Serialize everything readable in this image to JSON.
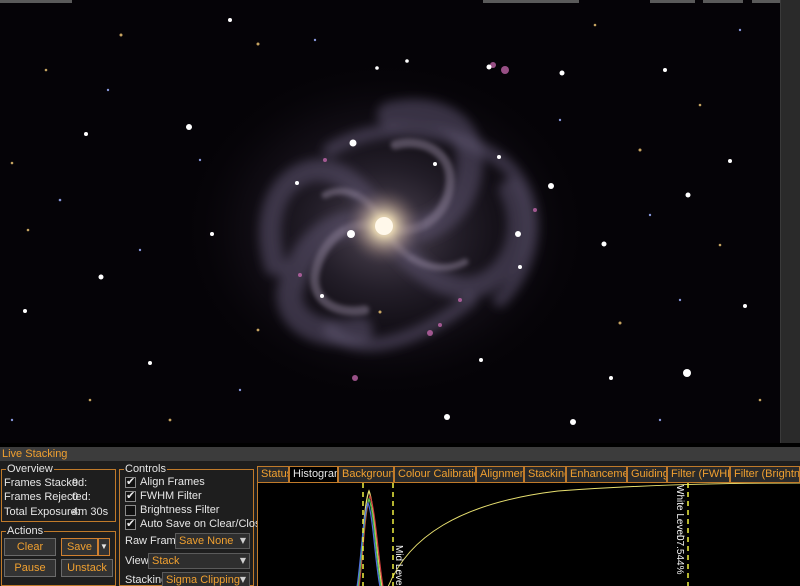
{
  "viewer": {
    "image": "galaxy-image"
  },
  "panel": {
    "title": "Live Stacking",
    "overview": {
      "legend": "Overview",
      "frames_stacked_label": "Frames Stacked:",
      "frames_stacked_value": "9",
      "frames_rejected_label": "Frames Rejected:",
      "frames_rejected_value": "0",
      "total_exposure_label": "Total Exposure:",
      "total_exposure_value": "4m 30s"
    },
    "actions": {
      "legend": "Actions",
      "clear": "Clear",
      "save": "Save",
      "pause": "Pause",
      "unstack": "Unstack"
    },
    "controls": {
      "legend": "Controls",
      "align_frames": "Align Frames",
      "fwhm_filter": "FWHM Filter",
      "brightness_filter": "Brightness Filter",
      "auto_save": "Auto Save on Clear/Close",
      "raw_frames_label": "Raw Frames",
      "raw_frames_value": "Save None",
      "view_label": "View",
      "view_value": "Stack",
      "stacking_label": "Stacking",
      "stacking_value": "Sigma Clipping"
    },
    "tabs": [
      "Status",
      "Histogram",
      "Background",
      "Colour Calibration",
      "Alignment",
      "Stacking",
      "Enhancement",
      "Guiding",
      "Filter (FWHM)",
      "Filter (Brightness"
    ],
    "active_tab": "Histogram",
    "histogram": {
      "mid_level_label": "Mid Level",
      "white_level_label": "White Level",
      "white_level_value": "07.544%"
    }
  },
  "checkbox_states": {
    "align_frames": true,
    "fwhm_filter": true,
    "brightness_filter": false,
    "auto_save": true
  },
  "colors": {
    "accent": "#f0a030",
    "border": "#c07a2a",
    "panel_bg": "#1e1e1e",
    "curve_yellow": "#e8e070",
    "marker_yellow": "#f0f040"
  },
  "icons": {
    "checkbox_tick": "check-icon",
    "dropdown": "chevron-down-icon"
  }
}
